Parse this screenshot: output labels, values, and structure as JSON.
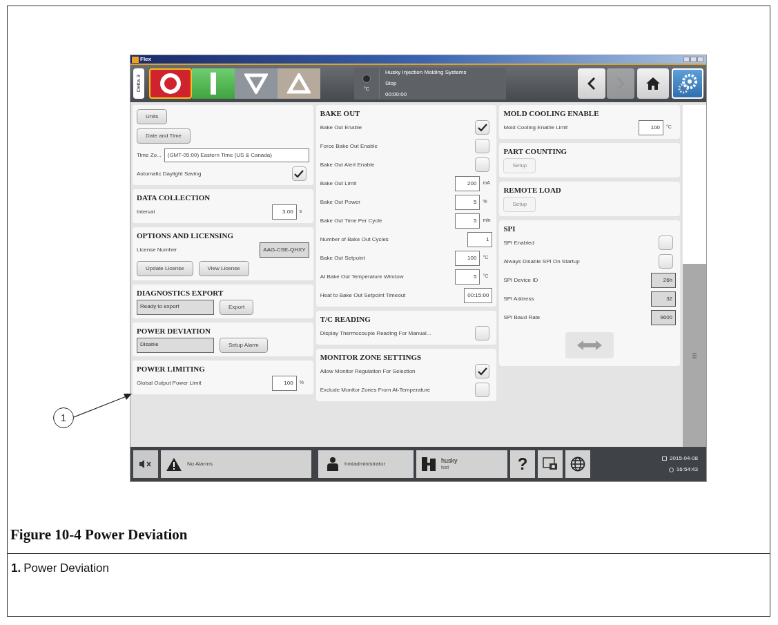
{
  "window": {
    "title": "Flex"
  },
  "toolbar": {
    "tab": "Delta 3",
    "machine_buttons": [
      {
        "kind": "stop",
        "selected": true
      },
      {
        "kind": "start",
        "selected": false
      },
      {
        "kind": "down",
        "selected": false
      },
      {
        "kind": "up",
        "selected": false
      }
    ],
    "status": {
      "unit": "°C",
      "company": "Husky Injection Molding Systems",
      "state": "Stop",
      "time": "00:00:00"
    },
    "nav": [
      {
        "kind": "back",
        "disabled": false
      },
      {
        "kind": "forward",
        "disabled": true
      },
      {
        "kind": "home",
        "disabled": false
      },
      {
        "kind": "settings",
        "disabled": false
      }
    ]
  },
  "columns": [
    [
      {
        "rows": [
          {
            "kind": "buttons",
            "buttons": [
              {
                "label": "Units",
                "disabled": false
              }
            ]
          },
          {
            "kind": "buttons",
            "buttons": [
              {
                "label": "Date and Time",
                "disabled": false
              }
            ]
          },
          {
            "kind": "select",
            "label": "Time Zo...",
            "value": "(GMT-05:00) Eastern Time (US & Canada)"
          },
          {
            "kind": "checkbox",
            "label": "Automatic Daylight Saving",
            "checked": true
          }
        ]
      },
      {
        "title": "DATA COLLECTION",
        "rows": [
          {
            "kind": "field",
            "label": "Interval",
            "value": "3.00",
            "unit": "s",
            "readonly": false
          }
        ]
      },
      {
        "title": "OPTIONS AND LICENSING",
        "rows": [
          {
            "kind": "field",
            "label": "License Number",
            "value": "AAG-CSE-QHXY",
            "readonly": true
          },
          {
            "kind": "buttons",
            "buttons": [
              {
                "label": "Update License",
                "disabled": false
              },
              {
                "label": "View License",
                "disabled": false
              }
            ]
          }
        ]
      },
      {
        "title": "DIAGNOSTICS EXPORT",
        "rows": [
          {
            "kind": "status",
            "value": "Ready to export",
            "button": "Export"
          }
        ]
      },
      {
        "title": "POWER DEVIATION",
        "rows": [
          {
            "kind": "status",
            "value": "Disable",
            "button": "Setup Alarm"
          }
        ]
      },
      {
        "title": "POWER LIMITING",
        "rows": [
          {
            "kind": "field",
            "label": "Global Output Power Limit",
            "value": "100",
            "unit": "%",
            "readonly": false
          }
        ]
      }
    ],
    [
      {
        "title": "BAKE OUT",
        "rows": [
          {
            "kind": "checkbox",
            "label": "Bake Out Enable",
            "checked": true
          },
          {
            "kind": "checkbox",
            "label": "Force Bake Out Enable",
            "checked": false
          },
          {
            "kind": "checkbox",
            "label": "Bake Out Alert Enable",
            "checked": false
          },
          {
            "kind": "field",
            "label": "Bake Out Limit",
            "value": "200",
            "unit": "mA",
            "readonly": false
          },
          {
            "kind": "field",
            "label": "Bake Out Power",
            "value": "5",
            "unit": "%",
            "readonly": false
          },
          {
            "kind": "field",
            "label": "Bake Out Time Per Cycle",
            "value": "5",
            "unit": "min",
            "readonly": false
          },
          {
            "kind": "field",
            "label": "Number of Bake Out Cycles",
            "value": "1",
            "readonly": false
          },
          {
            "kind": "field",
            "label": "Bake Out Setpoint",
            "value": "100",
            "unit": "°C",
            "readonly": false
          },
          {
            "kind": "field",
            "label": "At Bake Out Temperature Window",
            "value": "5",
            "unit": "°C",
            "readonly": false
          },
          {
            "kind": "field",
            "label": "Heat to Bake Out Setpoint Timeout",
            "value": "00:15:00",
            "readonly": false
          }
        ]
      },
      {
        "title": "T/C READING",
        "rows": [
          {
            "kind": "checkbox",
            "label": "Display Thermocouple Reading For Manual...",
            "checked": false
          }
        ]
      },
      {
        "title": "MONITOR ZONE SETTINGS",
        "rows": [
          {
            "kind": "checkbox",
            "label": "Allow Monitor Regulation For Selection",
            "checked": true
          },
          {
            "kind": "checkbox",
            "label": "Exclude Monitor Zones From At-Temperature",
            "checked": false
          }
        ]
      }
    ],
    [
      {
        "title": "MOLD COOLING ENABLE",
        "rows": [
          {
            "kind": "field",
            "label": "Mold Cooling Enable Limit",
            "value": "100",
            "unit": "°C",
            "readonly": false
          }
        ]
      },
      {
        "title": "PART COUNTING",
        "rows": [
          {
            "kind": "buttons",
            "buttons": [
              {
                "label": "Setup",
                "disabled": true
              }
            ]
          }
        ]
      },
      {
        "title": "REMOTE LOAD",
        "rows": [
          {
            "kind": "buttons",
            "buttons": [
              {
                "label": "Setup",
                "disabled": true
              }
            ]
          }
        ]
      },
      {
        "title": "SPI",
        "rows": [
          {
            "kind": "checkbox",
            "label": "SPI Enabled",
            "checked": false
          },
          {
            "kind": "checkbox",
            "label": "Always Disable SPI On Startup",
            "checked": false
          },
          {
            "kind": "field",
            "label": "SPI Device ID",
            "value": "26h",
            "readonly": true
          },
          {
            "kind": "field",
            "label": "SPI Address",
            "value": "32",
            "readonly": true
          },
          {
            "kind": "field",
            "label": "SPI Baud Rate",
            "value": "9600",
            "readonly": true
          },
          {
            "kind": "iconbutton",
            "disabled": true
          }
        ]
      }
    ]
  ],
  "status_bar": {
    "alarm": "No Alarms",
    "user": "hmiadministrator",
    "site": "husky",
    "site_sub": "test",
    "help": "?",
    "date": "2015-04-08",
    "time": "16:54:43"
  },
  "callout": {
    "number": "1"
  },
  "caption": {
    "title": "Figure 10-4 Power Deviation",
    "items": [
      {
        "number": "1.",
        "text": "Power Deviation"
      }
    ]
  }
}
